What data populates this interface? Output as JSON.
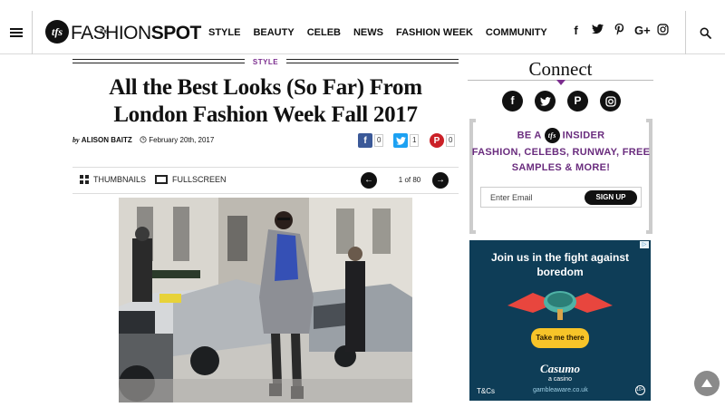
{
  "header": {
    "logo_text_light": "FASHION",
    "logo_text_bold": "SPOT",
    "logo_the": "the",
    "logo_mark": "tfs",
    "nav": [
      "STYLE",
      "BEAUTY",
      "CELEB",
      "NEWS",
      "FASHION WEEK",
      "COMMUNITY"
    ],
    "socials": [
      {
        "name": "facebook-icon",
        "glyph": "f"
      },
      {
        "name": "twitter-icon",
        "glyph": "t"
      },
      {
        "name": "pinterest-icon",
        "glyph": "p"
      },
      {
        "name": "google-plus-icon",
        "glyph": "G+"
      },
      {
        "name": "instagram-icon",
        "glyph": "◎"
      }
    ]
  },
  "article": {
    "category": "STYLE",
    "title": "All the Best Looks (So Far) From London Fashion Week Fall 2017",
    "by": "by",
    "author": "ALISON BAITZ",
    "date": "February 20th, 2017",
    "shares": {
      "facebook": "0",
      "twitter": "1",
      "pinterest": "0"
    }
  },
  "gallery": {
    "thumbnails_label": "THUMBNAILS",
    "fullscreen_label": "FULLSCREEN",
    "counter": "1 of 80",
    "prev_glyph": "←",
    "next_glyph": "→"
  },
  "sidebar": {
    "connect_title": "Connect",
    "insider_pre": "BE A",
    "insider_post": "INSIDER",
    "insider_mark": "tfs",
    "insider_tagline": "FASHION, CELEBS, RUNWAY, FREE SAMPLES & MORE!",
    "email_placeholder": "Enter Email",
    "signup_label": "SIGN UP"
  },
  "ad": {
    "headline": "Join us in the fight against boredom",
    "cta": "Take me there",
    "brand": "Casumo",
    "sub": "a casino",
    "terms": "T&Cs",
    "url": "gambleaware.co.uk",
    "age": "18+"
  },
  "colors": {
    "accent_purple": "#6a2c7e",
    "facebook": "#3b5998",
    "twitter": "#1da1f2",
    "pinterest": "#cb2027",
    "ad_bg": "#0e3d57",
    "ad_cta": "#f7c429"
  }
}
